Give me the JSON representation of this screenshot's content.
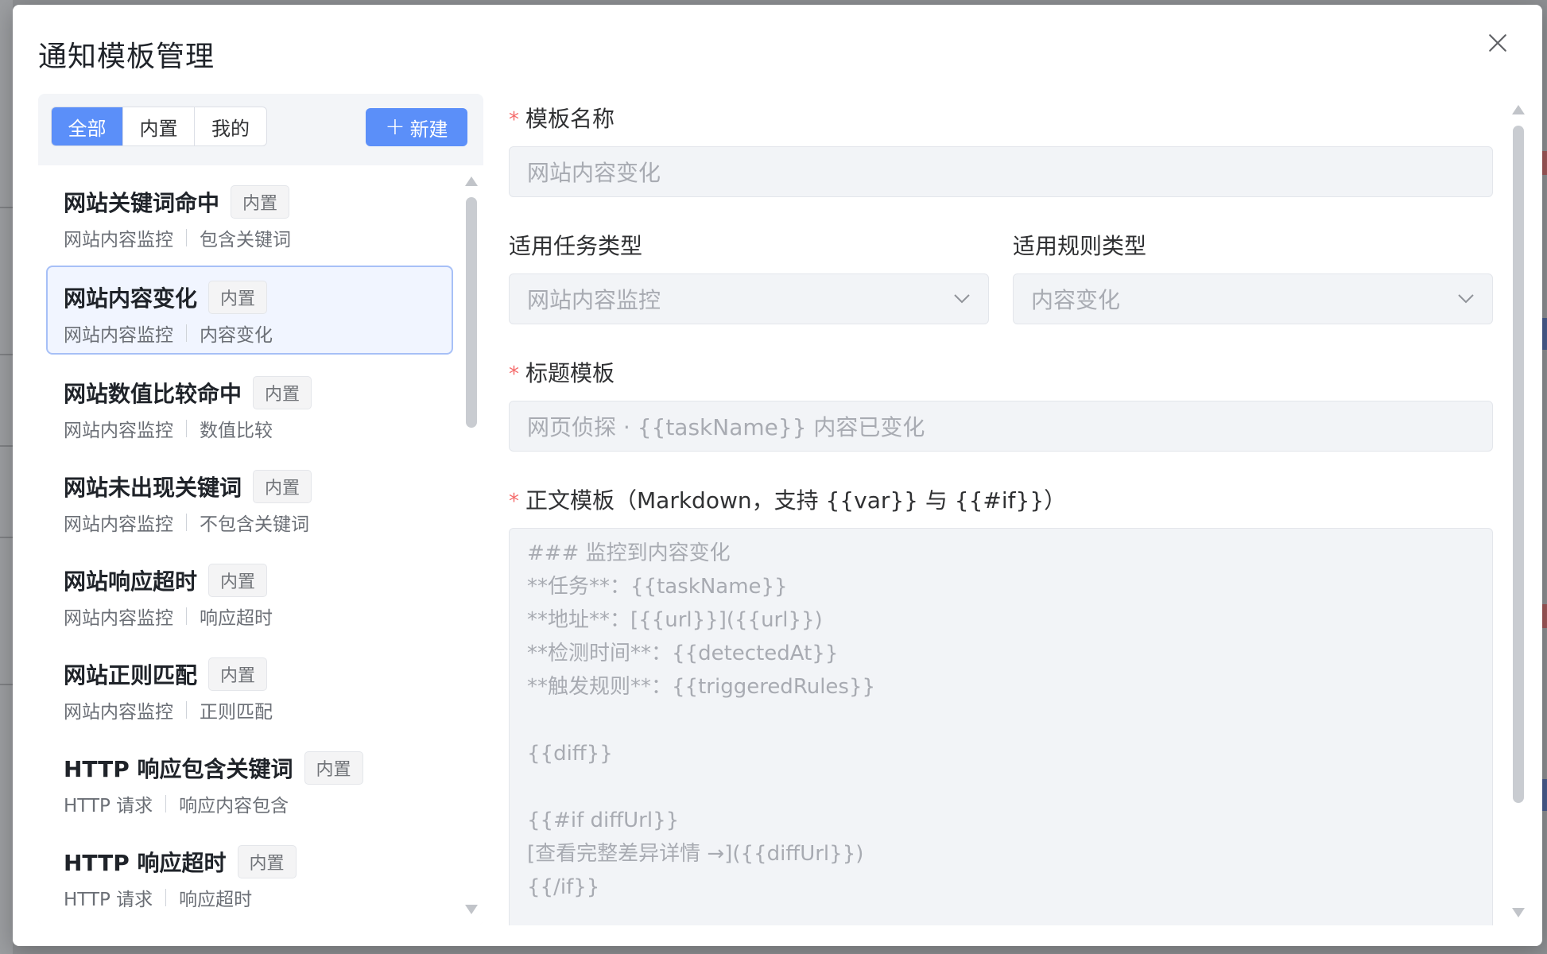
{
  "modal": {
    "title": "通知模板管理"
  },
  "left": {
    "tabs": [
      {
        "label": "全部",
        "active": true
      },
      {
        "label": "内置",
        "active": false
      },
      {
        "label": "我的",
        "active": false
      }
    ],
    "new_button": {
      "icon": "plus-icon",
      "label": "新建"
    },
    "templates": [
      {
        "name": "网站关键词命中",
        "badge": "内置",
        "task_type": "网站内容监控",
        "rule_type": "包含关键词",
        "selected": false
      },
      {
        "name": "网站内容变化",
        "badge": "内置",
        "task_type": "网站内容监控",
        "rule_type": "内容变化",
        "selected": true
      },
      {
        "name": "网站数值比较命中",
        "badge": "内置",
        "task_type": "网站内容监控",
        "rule_type": "数值比较",
        "selected": false
      },
      {
        "name": "网站未出现关键词",
        "badge": "内置",
        "task_type": "网站内容监控",
        "rule_type": "不包含关键词",
        "selected": false
      },
      {
        "name": "网站响应超时",
        "badge": "内置",
        "task_type": "网站内容监控",
        "rule_type": "响应超时",
        "selected": false
      },
      {
        "name": "网站正则匹配",
        "badge": "内置",
        "task_type": "网站内容监控",
        "rule_type": "正则匹配",
        "selected": false
      },
      {
        "name": "HTTP 响应包含关键词",
        "badge": "内置",
        "task_type": "HTTP 请求",
        "rule_type": "响应内容包含",
        "selected": false
      },
      {
        "name": "HTTP 响应超时",
        "badge": "内置",
        "task_type": "HTTP 请求",
        "rule_type": "响应超时",
        "selected": false
      }
    ]
  },
  "form": {
    "name_label": "模板名称",
    "name_value": "网站内容变化",
    "task_type_label": "适用任务类型",
    "task_type_value": "网站内容监控",
    "rule_type_label": "适用规则类型",
    "rule_type_value": "内容变化",
    "title_label": "标题模板",
    "title_value": "网页侦探 · {{taskName}} 内容已变化",
    "body_label": "正文模板（Markdown，支持 {{var}} 与 {{#if}}）",
    "body_lines": [
      "### 监控到内容变化",
      "**任务**：{{taskName}}",
      "**地址**：[{{url}}]({{url}})",
      "**检测时间**：{{detectedAt}}",
      "**触发规则**：{{triggeredRules}}",
      "",
      "{{diff}}",
      "",
      "{{#if diffUrl}}",
      "[查看完整差异详情 →]({{diffUrl}})",
      "{{/if}}"
    ],
    "required_mark": "*"
  },
  "colors": {
    "primary": "#5b8ff9",
    "required": "#f56c6c",
    "selected_bg": "#f1f5ff",
    "selected_border": "#a7c0f7"
  }
}
